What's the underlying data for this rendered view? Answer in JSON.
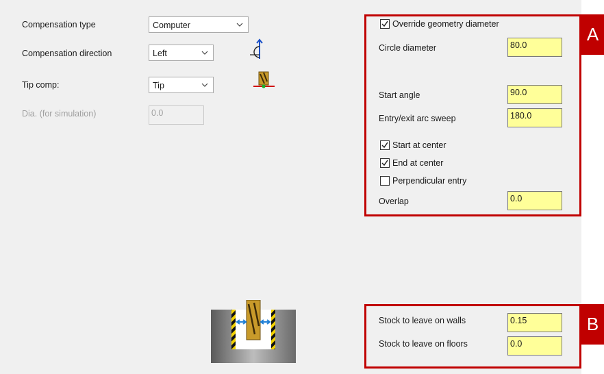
{
  "left": {
    "compensation_type": {
      "label": "Compensation type",
      "value": "Computer"
    },
    "compensation_direction": {
      "label": "Compensation direction",
      "value": "Left"
    },
    "tip_comp": {
      "label": "Tip comp:",
      "value": "Tip"
    },
    "dia_sim": {
      "label": "Dia. (for simulation)",
      "value": "0.0"
    }
  },
  "section_a": {
    "tag": "A",
    "override": {
      "label": "Override geometry diameter",
      "checked": true
    },
    "circle_diameter": {
      "label": "Circle diameter",
      "value": "80.0"
    },
    "start_angle": {
      "label": "Start angle",
      "value": "90.0"
    },
    "arc_sweep": {
      "label": "Entry/exit arc sweep",
      "value": "180.0"
    },
    "start_at_center": {
      "label": "Start at center",
      "checked": true
    },
    "end_at_center": {
      "label": "End at center",
      "checked": true
    },
    "perpendicular_entry": {
      "label": "Perpendicular entry",
      "checked": false
    },
    "overlap": {
      "label": "Overlap",
      "value": "0.0"
    }
  },
  "section_b": {
    "tag": "B",
    "stock_walls": {
      "label": "Stock to leave on walls",
      "value": "0.15"
    },
    "stock_floors": {
      "label": "Stock to leave on floors",
      "value": "0.0"
    }
  },
  "colors": {
    "highlight": "#c00000",
    "field_bg": "#ffff99",
    "panel_bg": "#f0f0f0"
  },
  "icons": [
    "chevron-down-icon",
    "compensation-direction-icon",
    "tip-comp-icon",
    "stock-to-leave-diagram"
  ]
}
